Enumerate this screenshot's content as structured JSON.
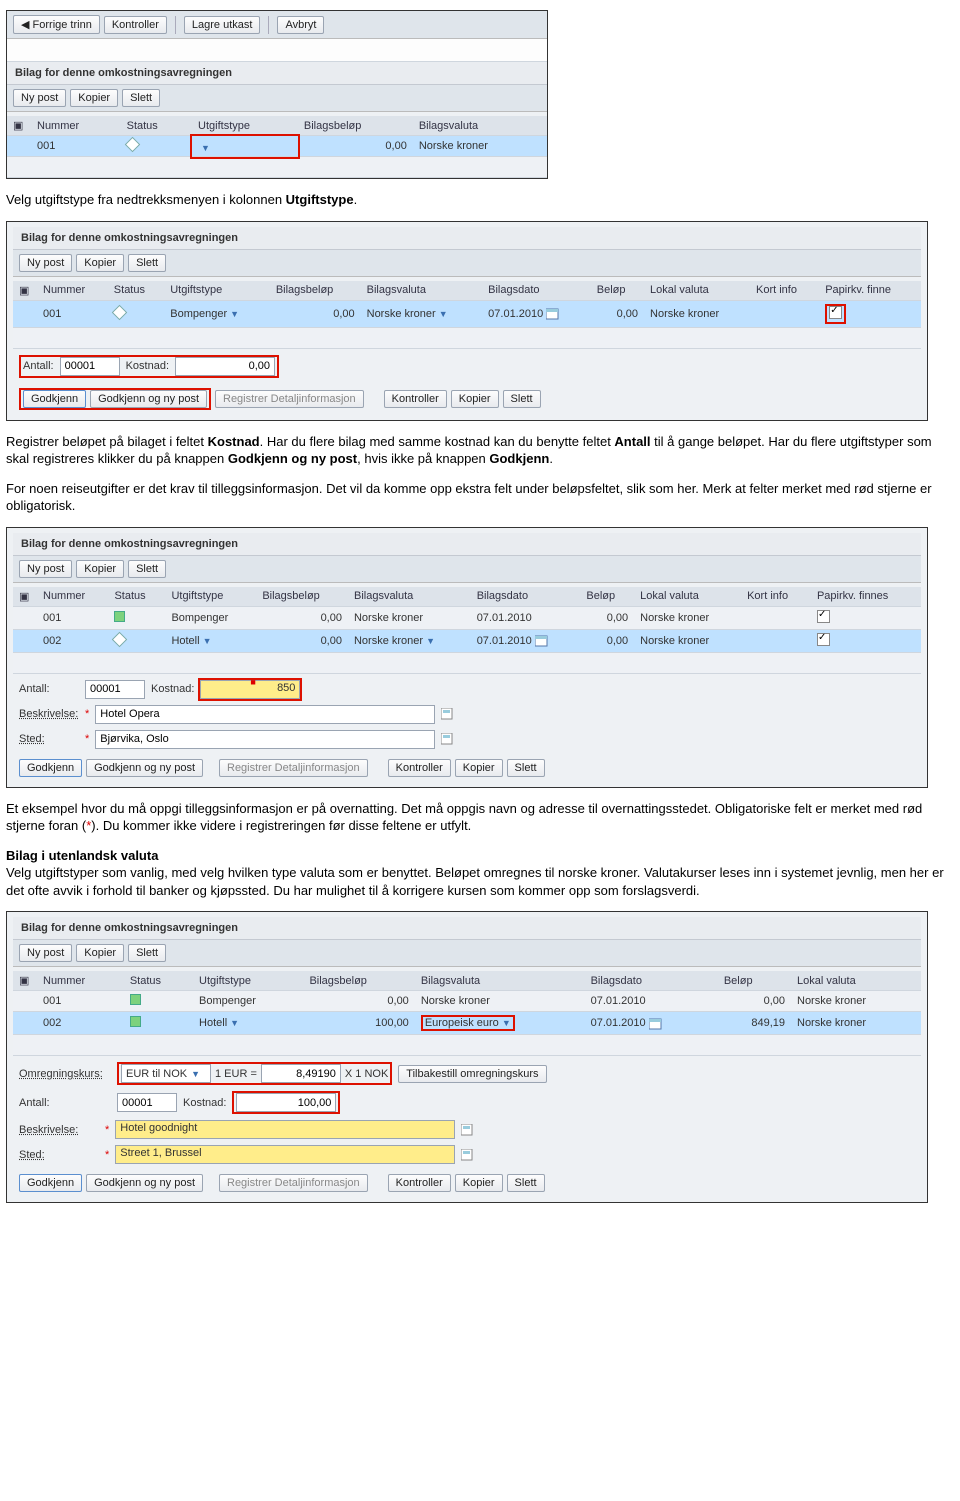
{
  "shot1": {
    "toolbar": {
      "prev": "Forrige trinn",
      "check": "Kontroller",
      "saveDraft": "Lagre utkast",
      "cancel": "Avbryt"
    },
    "title": "Bilag for denne omkostningsavregningen",
    "rowbar": {
      "new": "Ny post",
      "copy": "Kopier",
      "del": "Slett"
    },
    "cols": {
      "num": "Nummer",
      "status": "Status",
      "type": "Utgiftstype",
      "amt": "Bilagsbeløp",
      "cur": "Bilagsvaluta"
    },
    "row": {
      "num": "001",
      "type": "",
      "amt": "0,00",
      "cur": "Norske kroner"
    }
  },
  "p1_a": "Velg utgiftstype fra nedtrekksmenyen i kolonnen ",
  "p1_b": "Utgiftstype",
  "p1_c": ".",
  "shot2": {
    "title": "Bilag for denne omkostningsavregningen",
    "rowbar": {
      "new": "Ny post",
      "copy": "Kopier",
      "del": "Slett"
    },
    "cols": {
      "num": "Nummer",
      "status": "Status",
      "type": "Utgiftstype",
      "amt": "Bilagsbeløp",
      "cur": "Bilagsvaluta",
      "date": "Bilagsdato",
      "bel": "Beløp",
      "lcur": "Lokal valuta",
      "info": "Kort info",
      "paper": "Papirkv. finne"
    },
    "row": {
      "num": "001",
      "type": "Bompenger",
      "amt": "0,00",
      "cur": "Norske kroner",
      "date": "07.01.2010",
      "bel": "0,00",
      "lcur": "Norske kroner"
    },
    "detail": {
      "antL": "Antall:",
      "ant": "00001",
      "kostL": "Kostnad:",
      "kost": "0,00"
    },
    "bbar": {
      "ok": "Godkjenn",
      "oknew": "Godkjenn og ny post",
      "reg": "Registrer Detaljinformasjon",
      "check": "Kontroller",
      "copy": "Kopier",
      "del": "Slett"
    }
  },
  "p2_a": "Registrer beløpet på bilaget i feltet ",
  "p2_b": "Kostnad",
  "p2_c": ". Har du flere bilag med samme kostnad kan du benytte feltet ",
  "p2_d": "Antall",
  "p2_e": " til å gange beløpet. Har du flere utgiftstyper som skal registreres klikker du på knappen ",
  "p2_f": "Godkjenn og ny post",
  "p2_g": ", hvis ikke på knappen ",
  "p2_h": "Godkjenn",
  "p2_i": ".",
  "p3": "For noen reiseutgifter er det krav til tilleggsinformasjon. Det vil da komme opp ekstra felt under beløpsfeltet, slik som her. Merk at felter merket med rød stjerne er obligatorisk.",
  "shot3": {
    "title": "Bilag for denne omkostningsavregningen",
    "rowbar": {
      "new": "Ny post",
      "copy": "Kopier",
      "del": "Slett"
    },
    "cols": {
      "num": "Nummer",
      "status": "Status",
      "type": "Utgiftstype",
      "amt": "Bilagsbeløp",
      "cur": "Bilagsvaluta",
      "date": "Bilagsdato",
      "bel": "Beløp",
      "lcur": "Lokal valuta",
      "info": "Kort info",
      "paper": "Papirkv. finnes"
    },
    "rows": [
      {
        "num": "001",
        "type": "Bompenger",
        "amt": "0,00",
        "cur": "Norske kroner",
        "date": "07.01.2010",
        "bel": "0,00",
        "lcur": "Norske kroner"
      },
      {
        "num": "002",
        "type": "Hotell",
        "amt": "0,00",
        "cur": "Norske kroner",
        "date": "07.01.2010",
        "bel": "0,00",
        "lcur": "Norske kroner"
      }
    ],
    "detail": {
      "antL": "Antall:",
      "ant": "00001",
      "kostL": "Kostnad:",
      "kost": "850",
      "beskL": "Beskrivelse:",
      "besk": "Hotel Opera",
      "stedL": "Sted:",
      "sted": "Bjørvika, Oslo"
    },
    "bbar": {
      "ok": "Godkjenn",
      "oknew": "Godkjenn og ny post",
      "reg": "Registrer Detaljinformasjon",
      "check": "Kontroller",
      "copy": "Kopier",
      "del": "Slett"
    }
  },
  "p4_a": "Et eksempel hvor du må oppgi tilleggsinformasjon er på overnatting. Det må oppgis navn og adresse til overnattingsstedet. Obligatoriske felt er merket med rød stjerne foran (",
  "p4_b": "*",
  "p4_c": "). Du kommer ikke videre i registreringen før disse feltene er utfylt.",
  "h5": "Bilag i utenlandsk valuta",
  "p5": "Velg utgiftstyper som vanlig, med velg hvilken type valuta som er benyttet. Beløpet omregnes til norske kroner. Valutakurser leses inn i systemet jevnlig, men her er det ofte avvik i forhold til banker og kjøpssted. Du har mulighet til å korrigere kursen som kommer opp som forslagsverdi.",
  "shot4": {
    "title": "Bilag for denne omkostningsavregningen",
    "rowbar": {
      "new": "Ny post",
      "copy": "Kopier",
      "del": "Slett"
    },
    "cols": {
      "num": "Nummer",
      "status": "Status",
      "type": "Utgiftstype",
      "amt": "Bilagsbeløp",
      "cur": "Bilagsvaluta",
      "date": "Bilagsdato",
      "bel": "Beløp",
      "lcur": "Lokal valuta"
    },
    "rows": [
      {
        "num": "001",
        "type": "Bompenger",
        "amt": "0,00",
        "cur": "Norske kroner",
        "date": "07.01.2010",
        "bel": "0,00",
        "lcur": "Norske kroner"
      },
      {
        "num": "002",
        "type": "Hotell",
        "amt": "100,00",
        "cur": "Europeisk euro",
        "date": "07.01.2010",
        "bel": "849,19",
        "lcur": "Norske kroner"
      }
    ],
    "detail": {
      "rateL": "Omregningskurs:",
      "rateSel": "EUR til NOK",
      "unitA": "1 EUR =",
      "unitVal": "8,49190",
      "unitB": "X 1 NOK",
      "reset": "Tilbakestill omregningskurs",
      "antL": "Antall:",
      "ant": "00001",
      "kostL": "Kostnad:",
      "kost": "100,00",
      "beskL": "Beskrivelse:",
      "besk": "Hotel goodnight",
      "stedL": "Sted:",
      "sted": "Street 1, Brussel"
    },
    "bbar": {
      "ok": "Godkjenn",
      "oknew": "Godkjenn og ny post",
      "reg": "Registrer Detaljinformasjon",
      "check": "Kontroller",
      "copy": "Kopier",
      "del": "Slett"
    }
  }
}
